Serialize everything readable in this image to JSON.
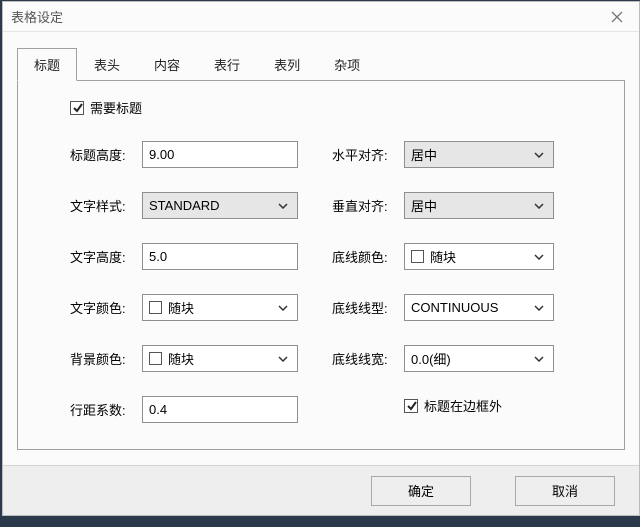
{
  "title": "表格设定",
  "tabs": [
    "标题",
    "表头",
    "内容",
    "表行",
    "表列",
    "杂项"
  ],
  "checkbox_need_title": "需要标题",
  "left_fields": {
    "height_label": "标题高度:",
    "height_value": "9.00",
    "textstyle_label": "文字样式:",
    "textstyle_value": "STANDARD",
    "textheight_label": "文字高度:",
    "textheight_value": "5.0",
    "textcolor_label": "文字颜色:",
    "textcolor_value": "随块",
    "bgcolor_label": "背景颜色:",
    "bgcolor_value": "随块",
    "linespace_label": "行距系数:",
    "linespace_value": "0.4"
  },
  "right_fields": {
    "halign_label": "水平对齐:",
    "halign_value": "居中",
    "valign_label": "垂直对齐:",
    "valign_value": "居中",
    "underline_color_label": "底线颜色:",
    "underline_color_value": "随块",
    "underline_type_label": "底线线型:",
    "underline_type_value": "CONTINUOUS",
    "underline_width_label": "底线线宽:",
    "underline_width_value": "0.0(细)"
  },
  "checkbox_outside_border": "标题在边框外",
  "buttons": {
    "ok": "确定",
    "cancel": "取消"
  }
}
